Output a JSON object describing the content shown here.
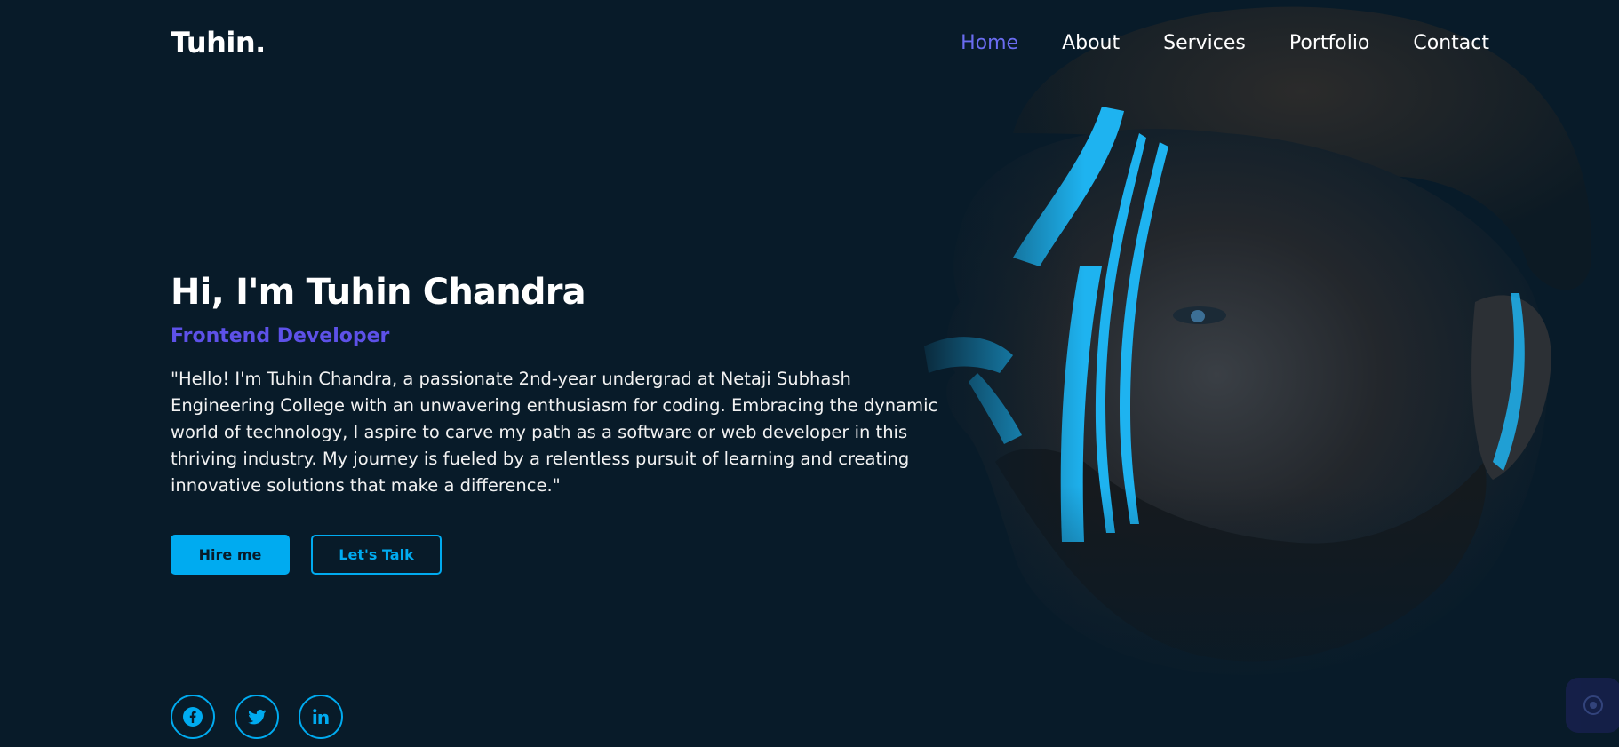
{
  "header": {
    "logo": "Tuhin.",
    "nav": [
      {
        "label": "Home",
        "active": true
      },
      {
        "label": "About",
        "active": false
      },
      {
        "label": "Services",
        "active": false
      },
      {
        "label": "Portfolio",
        "active": false
      },
      {
        "label": "Contact",
        "active": false
      }
    ]
  },
  "hero": {
    "title": "Hi, I'm Tuhin Chandra",
    "subtitle": "Frontend Developer",
    "description": "\"Hello! I'm Tuhin Chandra, a passionate 2nd-year undergrad at Netaji Subhash Engineering College with an unwavering enthusiasm for coding. Embracing the dynamic world of technology, I aspire to carve my path as a software or web developer in this thriving industry. My journey is fueled by a relentless pursuit of learning and creating innovative solutions that make a difference.\"",
    "buttons": {
      "primary_label": "Hire me",
      "secondary_label": "Let's Talk"
    }
  },
  "socials": [
    {
      "icon": "facebook-icon"
    },
    {
      "icon": "twitter-icon"
    },
    {
      "icon": "linkedin-icon"
    }
  ],
  "colors": {
    "background": "#081b29",
    "accent": "#00abf0",
    "nav_active": "#6a6cf0",
    "subtitle": "#5d51e8"
  }
}
